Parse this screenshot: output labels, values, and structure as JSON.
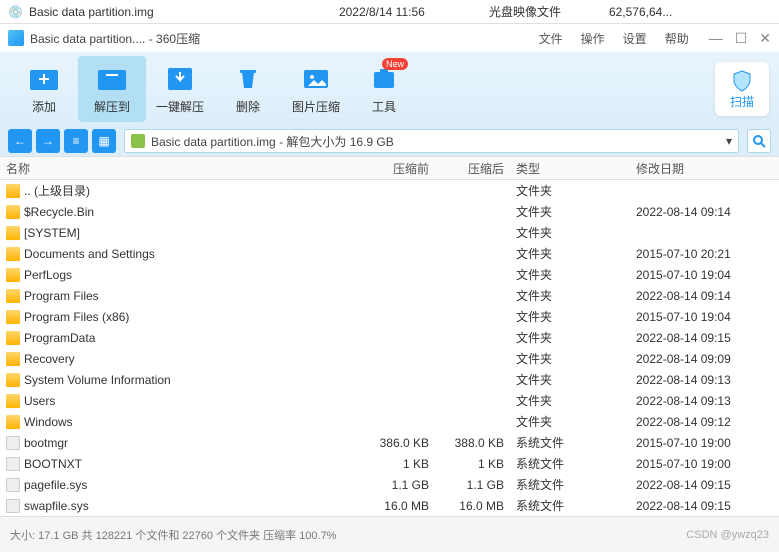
{
  "top": {
    "filename": "Basic data partition.img",
    "date": "2022/8/14 11:56",
    "type": "光盘映像文件",
    "size": "62,576,64..."
  },
  "titlebar": {
    "title": "Basic data partition.... - 360压缩",
    "menus": {
      "file": "文件",
      "operate": "操作",
      "settings": "设置",
      "help": "帮助"
    }
  },
  "toolbar": {
    "add": "添加",
    "extract_to": "解压到",
    "one_click": "一键解压",
    "delete": "删除",
    "image": "图片压缩",
    "tools": "工具",
    "badge": "New",
    "scan": "扫描"
  },
  "path": {
    "text": "Basic data partition.img - 解包大小为 16.9 GB"
  },
  "columns": {
    "name": "名称",
    "before": "压缩前",
    "after": "压缩后",
    "type": "类型",
    "date": "修改日期"
  },
  "files": [
    {
      "icon": "up",
      "name": ".. (上级目录)",
      "before": "",
      "after": "",
      "type": "文件夹",
      "date": ""
    },
    {
      "icon": "folder",
      "name": "$Recycle.Bin",
      "before": "",
      "after": "",
      "type": "文件夹",
      "date": "2022-08-14 09:14"
    },
    {
      "icon": "folder",
      "name": "[SYSTEM]",
      "before": "",
      "after": "",
      "type": "文件夹",
      "date": ""
    },
    {
      "icon": "folder",
      "name": "Documents and Settings",
      "before": "",
      "after": "",
      "type": "文件夹",
      "date": "2015-07-10 20:21"
    },
    {
      "icon": "folder",
      "name": "PerfLogs",
      "before": "",
      "after": "",
      "type": "文件夹",
      "date": "2015-07-10 19:04"
    },
    {
      "icon": "folder",
      "name": "Program Files",
      "before": "",
      "after": "",
      "type": "文件夹",
      "date": "2022-08-14 09:14"
    },
    {
      "icon": "folder",
      "name": "Program Files (x86)",
      "before": "",
      "after": "",
      "type": "文件夹",
      "date": "2015-07-10 19:04"
    },
    {
      "icon": "folder",
      "name": "ProgramData",
      "before": "",
      "after": "",
      "type": "文件夹",
      "date": "2022-08-14 09:15"
    },
    {
      "icon": "folder",
      "name": "Recovery",
      "before": "",
      "after": "",
      "type": "文件夹",
      "date": "2022-08-14 09:09"
    },
    {
      "icon": "folder",
      "name": "System Volume Information",
      "before": "",
      "after": "",
      "type": "文件夹",
      "date": "2022-08-14 09:13"
    },
    {
      "icon": "folder",
      "name": "Users",
      "before": "",
      "after": "",
      "type": "文件夹",
      "date": "2022-08-14 09:13"
    },
    {
      "icon": "folder",
      "name": "Windows",
      "before": "",
      "after": "",
      "type": "文件夹",
      "date": "2022-08-14 09:12"
    },
    {
      "icon": "file",
      "name": "bootmgr",
      "before": "386.0 KB",
      "after": "388.0 KB",
      "type": "系统文件",
      "date": "2015-07-10 19:00"
    },
    {
      "icon": "file",
      "name": "BOOTNXT",
      "before": "1 KB",
      "after": "1 KB",
      "type": "系统文件",
      "date": "2015-07-10 19:00"
    },
    {
      "icon": "file",
      "name": "pagefile.sys",
      "before": "1.1 GB",
      "after": "1.1 GB",
      "type": "系统文件",
      "date": "2022-08-14 09:15"
    },
    {
      "icon": "file",
      "name": "swapfile.sys",
      "before": "16.0 MB",
      "after": "16.0 MB",
      "type": "系统文件",
      "date": "2022-08-14 09:15"
    }
  ],
  "status": {
    "text": "大小: 17.1 GB 共 128221 个文件和 22760 个文件夹 压缩率 100.7%",
    "watermark": "CSDN @ywzq23"
  }
}
